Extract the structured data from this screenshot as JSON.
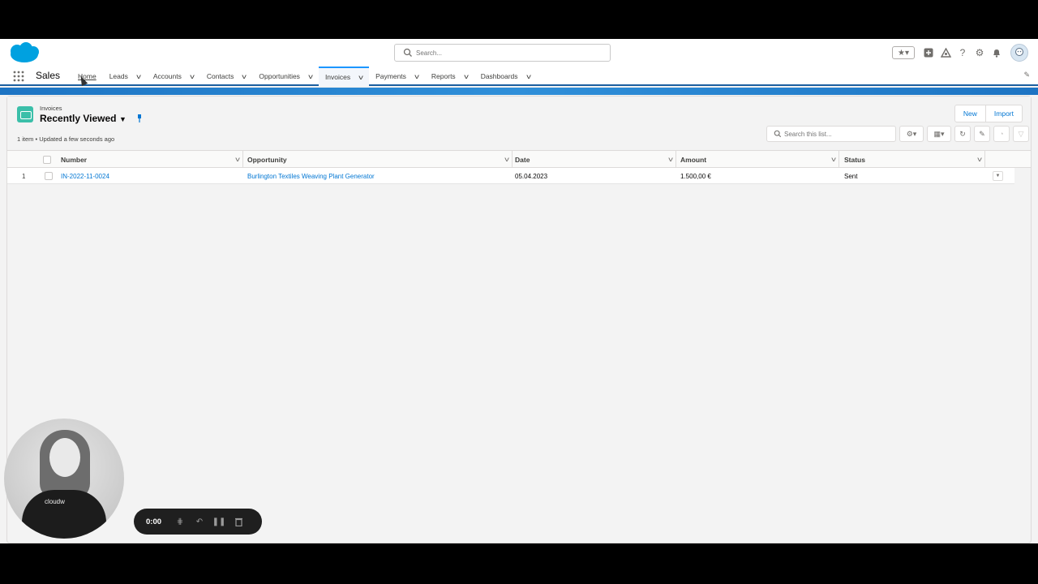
{
  "header": {
    "search_placeholder": "Search...",
    "icons": [
      "favorites-star-icon",
      "add-icon",
      "trailhead-icon",
      "help-icon",
      "setup-gear-icon",
      "notifications-bell-icon",
      "user-avatar"
    ]
  },
  "nav": {
    "app_name": "Sales",
    "items": [
      {
        "label": "Home",
        "has_menu": false
      },
      {
        "label": "Leads",
        "has_menu": true
      },
      {
        "label": "Accounts",
        "has_menu": true
      },
      {
        "label": "Contacts",
        "has_menu": true
      },
      {
        "label": "Opportunities",
        "has_menu": true
      },
      {
        "label": "Invoices",
        "has_menu": true,
        "active": true
      },
      {
        "label": "Payments",
        "has_menu": true
      },
      {
        "label": "Reports",
        "has_menu": true
      },
      {
        "label": "Dashboards",
        "has_menu": true
      }
    ]
  },
  "list": {
    "object_label": "Invoices",
    "view_name": "Recently Viewed",
    "meta": "1 item • Updated a few seconds ago",
    "buttons": {
      "new": "New",
      "import": "Import"
    },
    "search_placeholder": "Search this list...",
    "columns": [
      "Number",
      "Opportunity",
      "Date",
      "Amount",
      "Status"
    ],
    "rows": [
      {
        "index": "1",
        "number": "IN-2022-11-0024",
        "opportunity": "Burlington Textiles Weaving Plant Generator",
        "date": "05.04.2023",
        "amount": "1.500,00 €",
        "status": "Sent"
      }
    ]
  },
  "presenter": {
    "shirt_text": "cloudw"
  },
  "recorder": {
    "time": "0:00"
  },
  "colors": {
    "accent": "#0176d3",
    "object_icon": "#3bbfa9",
    "band": "#1d74c3"
  }
}
